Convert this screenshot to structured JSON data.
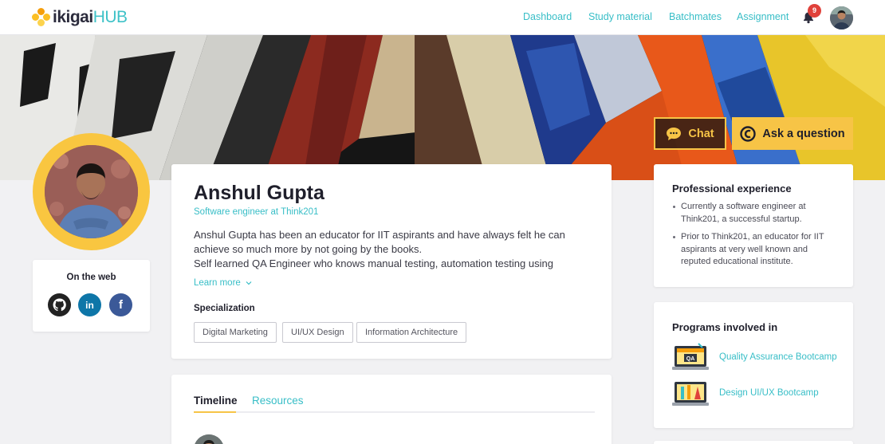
{
  "brand": {
    "name_part1": "ikigai",
    "name_part2": "HUB"
  },
  "nav": [
    {
      "label": "Dashboard"
    },
    {
      "label": "Study material"
    },
    {
      "label": "Batchmates"
    },
    {
      "label": "Assignment"
    }
  ],
  "notifications": {
    "count": "9"
  },
  "actions": {
    "chat_label": "Chat",
    "ask_label": "Ask a question"
  },
  "web": {
    "title": "On the web",
    "icons": [
      "github-icon",
      "linkedin-icon",
      "facebook-icon"
    ]
  },
  "profile": {
    "name": "Anshul Gupta",
    "role": "Software engineer at Think201",
    "bio_line1": "Anshul Gupta has been an educator for IIT aspirants and have always felt he can",
    "bio_line2": "achieve so much more by not going by the books.",
    "bio_line3": "Self learned QA Engineer who knows manual testing, automation testing using",
    "learn_more": "Learn more",
    "specialization_title": "Specialization",
    "tags": [
      "Digital Marketing",
      "UI/UX Design",
      "Information Architecture"
    ]
  },
  "tabs": [
    {
      "label": "Timeline",
      "active": true
    },
    {
      "label": "Resources",
      "active": false
    }
  ],
  "experience": {
    "title": "Professional experience",
    "items": [
      "Currently a software engineer at Think201, a successful startup.",
      "Prior to Think201, an educator for IIT aspirants at very well known and reputed educational institute."
    ]
  },
  "programs": {
    "title": "Programs involved in",
    "items": [
      {
        "label": "Quality Assurance Bootcamp",
        "icon": "qa-laptop-icon"
      },
      {
        "label": "Design UI/UX Bootcamp",
        "icon": "design-tools-icon"
      }
    ]
  },
  "colors": {
    "accent": "#38bec7",
    "brand_yellow": "#f7c446",
    "badge_red": "#e0413a"
  }
}
